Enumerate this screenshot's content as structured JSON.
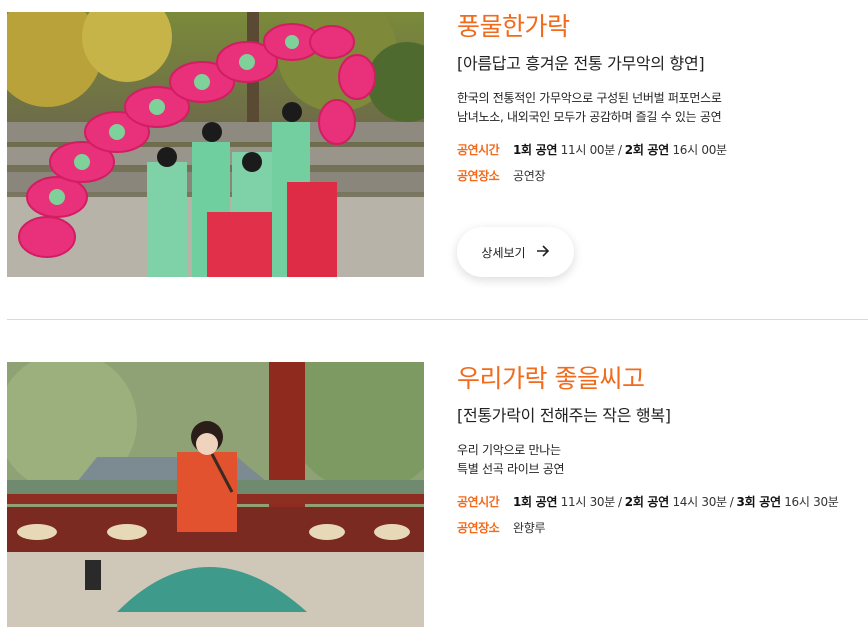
{
  "programs": [
    {
      "title": "풍물한가락",
      "subtitle": "[아름답고 흥겨운 전통 가무악의 향연]",
      "desc": [
        "한국의 전통적인 가무악으로 구성된 넌버벌 퍼포먼스로",
        "남녀노소, 내외국인 모두가 공감하며 즐길 수 있는 공연"
      ],
      "time_label": "공연시간",
      "sessions": [
        {
          "name": "1회 공연",
          "time": "11시 00분"
        },
        {
          "name": "2회 공연",
          "time": "16시 00분"
        }
      ],
      "place_label": "공연장소",
      "place": "공연장",
      "button_label": "상세보기",
      "button_icon": "arrow-right-icon",
      "image_alt": "fan-dance-photo"
    },
    {
      "title": "우리가락 좋을씨고",
      "subtitle": "[전통가락이 전해주는 작은 행복]",
      "desc": [
        "우리 기악으로 만나는",
        "특별 선곡 라이브 공연"
      ],
      "time_label": "공연시간",
      "sessions": [
        {
          "name": "1회 공연",
          "time": "11시 30분"
        },
        {
          "name": "2회 공연",
          "time": "14시 30분"
        },
        {
          "name": "3회 공연",
          "time": "16시 30분"
        }
      ],
      "place_label": "공연장소",
      "place": "완향루",
      "image_alt": "flute-player-photo"
    }
  ],
  "colors": {
    "accent": "#f26a1b",
    "divider": "#d9d9d9"
  }
}
